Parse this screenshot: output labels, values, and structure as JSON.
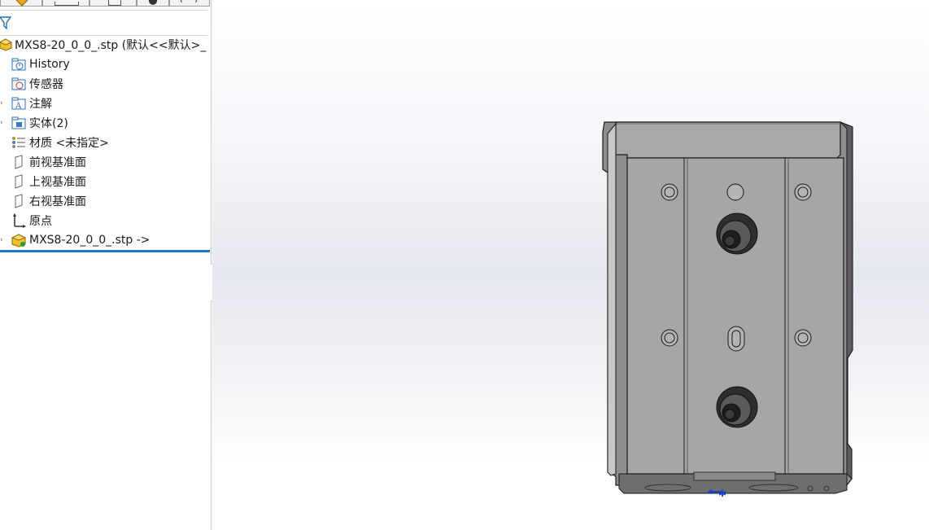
{
  "tree": {
    "root_label": "MXS8-20_0_0_.stp  (默认<<默认>_",
    "items": [
      {
        "label": "History",
        "icon": "history-folder-icon"
      },
      {
        "label": "传感器",
        "icon": "sensor-folder-icon"
      },
      {
        "label": "注解",
        "icon": "annotation-folder-icon"
      },
      {
        "label": "实体(2)",
        "icon": "solid-bodies-folder-icon"
      },
      {
        "label": "材质 <未指定>",
        "icon": "material-icon"
      },
      {
        "label": "前视基准面",
        "icon": "plane-icon"
      },
      {
        "label": "上视基准面",
        "icon": "plane-icon"
      },
      {
        "label": "右视基准面",
        "icon": "plane-icon"
      },
      {
        "label": "原点",
        "icon": "origin-icon"
      },
      {
        "label": "MXS8-20_0_0_.stp ->",
        "icon": "imported-part-icon"
      }
    ]
  },
  "colors": {
    "accent": "#1f77c9",
    "part_face": "#a4a4a4",
    "part_edge": "#1a1a1a",
    "folder_icon": "#2c6fb3"
  }
}
